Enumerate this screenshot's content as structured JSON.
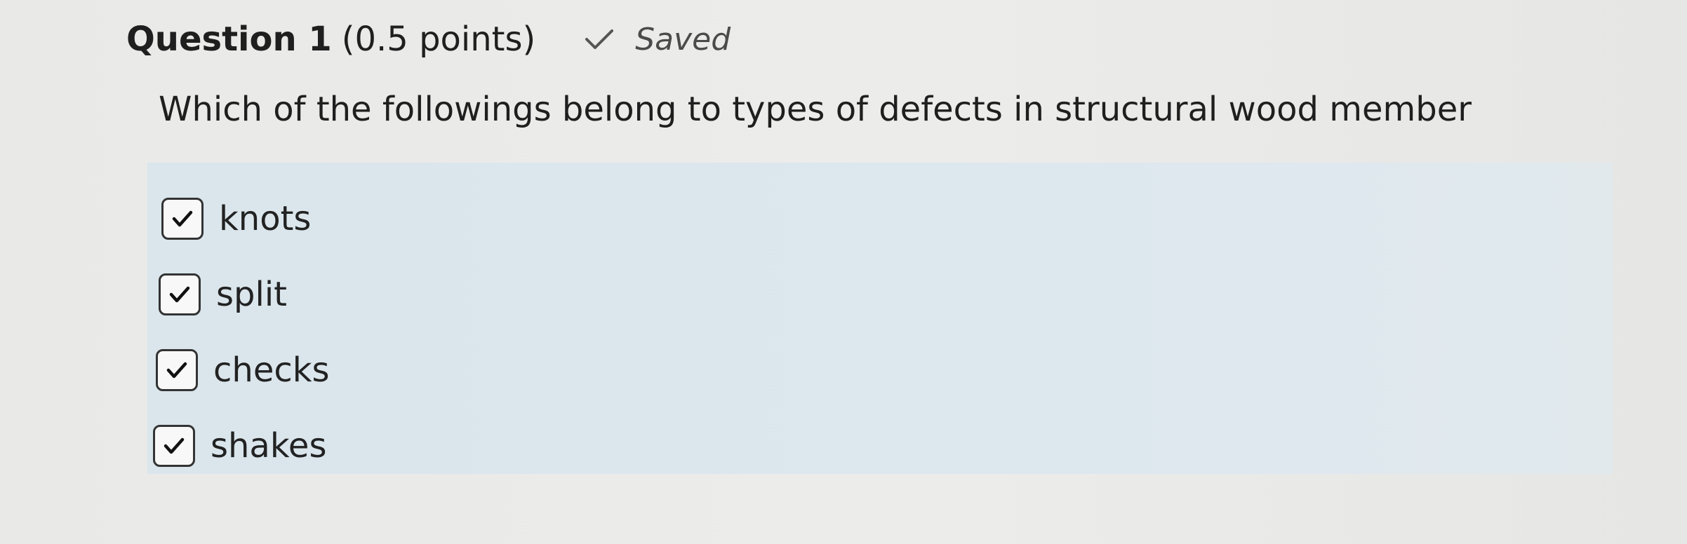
{
  "question": {
    "title": "Question 1",
    "points": "(0.5 points)",
    "status": "Saved",
    "status_icon": "check-icon",
    "text": "Which of the followings belong to types of defects in structural wood member"
  },
  "options": [
    {
      "label": "knots",
      "checked": true
    },
    {
      "label": "split",
      "checked": true
    },
    {
      "label": "checks",
      "checked": true
    },
    {
      "label": "shakes",
      "checked": true
    }
  ],
  "colors": {
    "page_background": "#e9e9e7",
    "answers_background": "#dae6ec",
    "checkbox_border": "#333333",
    "status_text": "#4b4b4b"
  }
}
